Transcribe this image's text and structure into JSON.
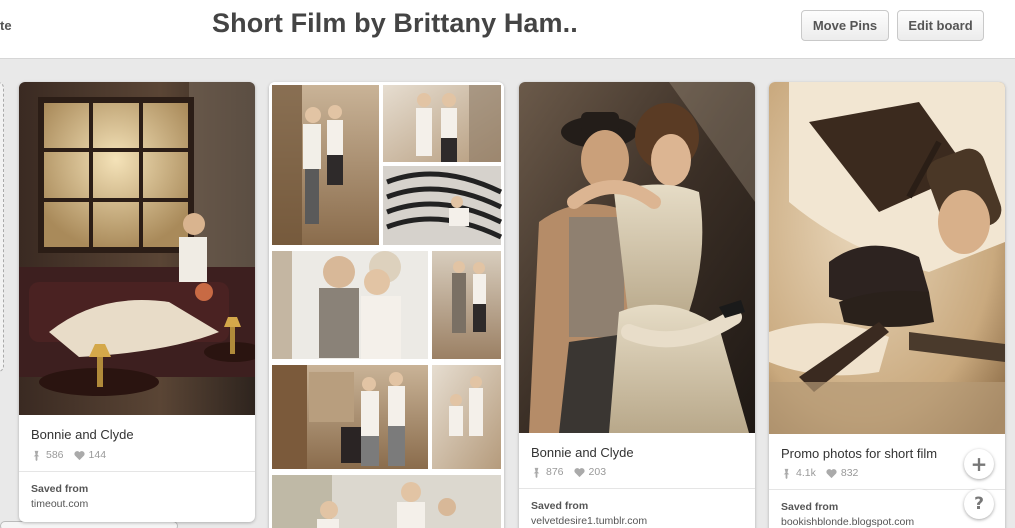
{
  "header": {
    "left_fragment": "te",
    "board_title": "Short Film by Brittany Ham..",
    "move_pins_label": "Move Pins",
    "edit_board_label": "Edit board"
  },
  "pins": [
    {
      "description": "Bonnie and Clyde",
      "repins": "586",
      "likes": "144",
      "saved_label": "Saved from",
      "source": "timeout.com"
    },
    {
      "description": "",
      "repins": "",
      "likes": "",
      "saved_label": "",
      "source": ""
    },
    {
      "description": "Bonnie and Clyde",
      "repins": "876",
      "likes": "203",
      "saved_label": "Saved from",
      "source": "velvetdesire1.tumblr.com"
    },
    {
      "description": "Promo photos for short film",
      "repins": "4.1k",
      "likes": "832",
      "saved_label": "Saved from",
      "source": "bookishblonde.blogspot.com"
    }
  ],
  "floating": {
    "add_symbol": "+",
    "help_symbol": "?"
  },
  "icons": {
    "repin": "pin-icon",
    "like": "heart-icon"
  },
  "colors": {
    "header_bg": "#ffffff",
    "page_bg": "#e9e9e9",
    "sepia": "#b08a5e"
  }
}
